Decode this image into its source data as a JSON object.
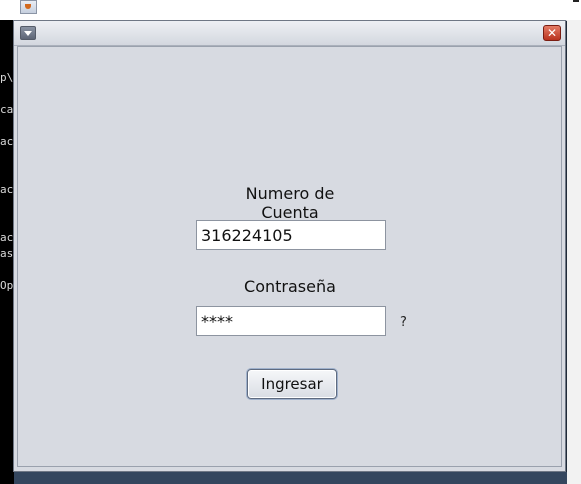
{
  "terminal": {
    "lines": [
      "p\\",
      "ca",
      "ac",
      "ac",
      "ac",
      "as",
      "Op"
    ]
  },
  "dialog": {
    "account_label": "Numero de Cuenta",
    "account_value": "316224105",
    "password_label": "Contraseña",
    "password_value": "****",
    "hint": "?",
    "submit_label": "Ingresar",
    "close_glyph": "✕"
  },
  "icons": {
    "menu": "chevron-down-icon",
    "close": "close-icon",
    "app": "java-icon"
  },
  "colors": {
    "dialog_bg": "#d7dae1",
    "close_button": "#c74730"
  }
}
